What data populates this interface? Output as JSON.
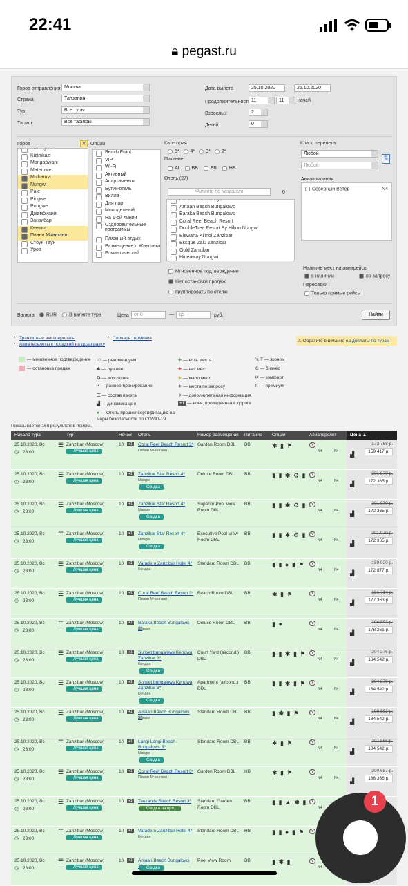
{
  "status": {
    "time": "22:41"
  },
  "browser": {
    "url": "pegast.ru"
  },
  "form": {
    "city_from_label": "Город отправления",
    "city_from": "Москва",
    "country_label": "Страна",
    "country": "Танзания",
    "tour_label": "Тур",
    "tour": "Все туры",
    "tariff_label": "Тариф",
    "tariff": "Все тарифы",
    "date_label": "Дата вылета",
    "date_from": "25.10.2020",
    "date_to": "25.10.2020",
    "duration_label": "Продолжительность",
    "dur_from": "11",
    "dur_to": "11",
    "nights": "ночей",
    "adults_label": "Взрослых",
    "adults": "2",
    "children_label": "Детей",
    "children": "0",
    "city_label": "Город",
    "options_label": "Опции",
    "category_label": "Категория",
    "cats": [
      "5*",
      "4*",
      "3*",
      "2*"
    ],
    "meal_label": "Питание",
    "meals": [
      "AI",
      "BB",
      "FB",
      "HB"
    ],
    "hotel_label": "Отель (27)",
    "hotel_placeholder": "Фильтр по названию",
    "hotel_count": "0",
    "class_label": "Класс перелета",
    "class_1": "Любой",
    "class_2": "Любой",
    "airlines_label": "Авиакомпании",
    "airline": "Северный Ветер",
    "airline_code": "N4",
    "avail_label": "Наличие мест на авиарейсы",
    "avail_yes": "в наличии",
    "avail_req": "по запросу",
    "transfers_label": "Пересадки",
    "direct_only": "Только прямые рейсы",
    "instant": "Мгновенное подтверждение",
    "no_stop": "Нет остановки продаж",
    "group": "Группировать по отелю",
    "currency_label": "Валюта",
    "cur_rub": "RUR",
    "cur_tour": "В валюте тура",
    "price_label": "Цена",
    "price_from": "от 0",
    "price_to": "до --",
    "rub": "руб.",
    "find": "Найти",
    "cities": [
      {
        "n": "Kiwengwa",
        "on": false
      },
      {
        "n": "Kizimkazi",
        "on": false
      },
      {
        "n": "Mangapwani",
        "on": false
      },
      {
        "n": "Matemwe",
        "on": false
      },
      {
        "n": "Michamvi",
        "on": true
      },
      {
        "n": "Nungwi",
        "on": true
      },
      {
        "n": "Paje",
        "on": false
      },
      {
        "n": "Pingwe",
        "on": false
      },
      {
        "n": "Pongwe",
        "on": false
      },
      {
        "n": "Джамбиани",
        "on": false
      },
      {
        "n": "Занзибар",
        "on": false
      },
      {
        "n": "Кендва",
        "on": true
      },
      {
        "n": "Пвани Мчангани",
        "on": true
      },
      {
        "n": "Стоун Таун",
        "on": false
      },
      {
        "n": "Уроа",
        "on": false
      }
    ],
    "options": [
      "Beach Front",
      "VIP",
      "Wi-Fi",
      "Активный",
      "Апартаменты",
      "Бутик-отель",
      "Вилла",
      "Для пар",
      "Молодежный",
      "На 1-ой линии",
      "Оздоровительные программы",
      "Пляжный отдых",
      "Размещение с Животными",
      "Романтический"
    ],
    "hotels": [
      "Aluna Beach Lodge",
      "Amaan Beach Bungalows",
      "Baraka Beach Bungalows",
      "Coral Reef Beach Resort",
      "DoubleTree Resort By Hilton Nungwi",
      "Elewana Kilindi Zanzibar",
      "Essque Zalu Zanzibar",
      "Gold Zanzibar",
      "Hideaway Nungwi"
    ]
  },
  "links": {
    "transit": "Транзитные авиаперелеты",
    "terms": "Словарь терминов",
    "flights": "Авиаперелеты с посадкой на дозаправку",
    "notice": "Обратите внимание",
    "extra": "на доплаты по турам"
  },
  "legend": {
    "instant": "— мгновенное подтверждение",
    "stop": "— остановка продаж",
    "rec": "— рекомендуем",
    "best": "— лучшее",
    "excl": "— эксклюзив",
    "early": "— раннее бронирование",
    "pack": "— состав пакета",
    "dyn": "— динамика цен",
    "covid": "— Отель прошел сертификацию на меры безопасности по COVID-19",
    "seats": "— есть места",
    "noseats": "— нет мест",
    "few": "— мало мест",
    "req": "— места по запросу",
    "info": "— дополнительная информация",
    "night": "— ночь, проведенная в дороге",
    "econ": "Y, T — эконом",
    "bus": "C — бизнес",
    "comf": "K — комфорт",
    "prem": "P — премиум"
  },
  "results_count": "Показывается 168 результатов поиска.",
  "table": {
    "h_start": "Начало тура",
    "h_tour": "Тур",
    "h_nights": "Ночей",
    "h_hotel": "Отель",
    "h_room": "Номер размещения",
    "h_meal": "Питание",
    "h_opts": "Опции",
    "h_air": "Авиаперелет",
    "h_price": "Цена ▲"
  },
  "rows": [
    {
      "date": "25.10.2020, Вс",
      "time": "23:00",
      "tour": "Zanzibar (Moscow)",
      "badge": "Лучшая цена",
      "n": "10",
      "hotel": "Coral Reef Beach Resort 3*",
      "town": "Пвани Мчангани",
      "room": "Garden Room DBL",
      "meal": "BB",
      "icons": "✱ ▮ ⚑",
      "old": "173 768 р.",
      "price": "159 417 р.",
      "extra": ""
    },
    {
      "date": "25.10.2020, Вс",
      "time": "23:00",
      "tour": "Zanzibar (Moscow)",
      "badge": "Лучшая цена",
      "n": "10",
      "hotel": "Zanzibar Star Resort 4*",
      "town": "Nungwi",
      "room": "Deluxe Room DBL",
      "meal": "BB",
      "icons": "▮ ▮ ✱ ⚙ ▮ ⚑",
      "old": "201 970 р.",
      "price": "172 365 р.",
      "extra": "Скидка"
    },
    {
      "date": "25.10.2020, Вс",
      "time": "23:00",
      "tour": "Zanzibar (Moscow)",
      "badge": "Лучшая цена",
      "n": "10",
      "hotel": "Zanzibar Star Resort 4*",
      "town": "Nungwi",
      "room": "Superior Pool View Room DBL",
      "meal": "BB",
      "icons": "▮ ▮ ✱ ⚙ ▮ ⚑",
      "old": "201 970 р.",
      "price": "172 365 р.",
      "extra": "Скидка"
    },
    {
      "date": "25.10.2020, Вс",
      "time": "23:00",
      "tour": "Zanzibar (Moscow)",
      "badge": "Лучшая цена",
      "n": "10",
      "hotel": "Zanzibar Star Resort 4*",
      "town": "Nungwi",
      "room": "Executive Pool View Room DBL",
      "meal": "BB",
      "icons": "▮ ▮ ✱ ⚙ ▮ ⚑",
      "old": "201 970 р.",
      "price": "172 365 р.",
      "extra": "Скидка"
    },
    {
      "date": "25.10.2020, Вс",
      "time": "23:00",
      "tour": "Zanzibar (Moscow)",
      "badge": "Лучшая цена",
      "n": "10",
      "hotel": "Varadero Zanzibar Hotel 4*",
      "town": "Кендва",
      "room": "Standard Room DBL",
      "meal": "BB",
      "icons": "▮ ▮ ● ▮ ⚑",
      "old": "189 920 р.",
      "price": "172 877 р.",
      "extra": ""
    },
    {
      "date": "25.10.2020, Вс",
      "time": "23:00",
      "tour": "Zanzibar (Moscow)",
      "badge": "Лучшая цена",
      "n": "10",
      "hotel": "Coral Reef Beach Resort 3*",
      "town": "Пвани Мчангани",
      "room": "Beach Room DBL",
      "meal": "BB",
      "icons": "✱ ▮ ⚑",
      "old": "191 714 р.",
      "price": "177 363 р.",
      "extra": ""
    },
    {
      "date": "25.10.2020, Вс",
      "time": "23:00",
      "tour": "Zanzibar (Moscow)",
      "badge": "Лучшая цена",
      "n": "10",
      "hotel": "Baraka Beach Bungalows 2*",
      "town": "Nungwi",
      "room": "Deluxe Room DBL",
      "meal": "BB",
      "icons": "▮ ●",
      "old": "198 893 р.",
      "price": "178 261 р.",
      "extra": ""
    },
    {
      "date": "25.10.2020, Вс",
      "time": "23:00",
      "tour": "Zanzibar (Moscow)",
      "badge": "Лучшая цена",
      "n": "10",
      "hotel": "Sunset bungalows Kendwa Zanzibar 3*",
      "town": "Кендва",
      "room": "Court Yard (aircond.) DBL",
      "meal": "BB",
      "icons": "▮ ▮ ✱ ▮ ⚑",
      "old": "204 276 р.",
      "price": "184 542 р.",
      "extra": "Скидка"
    },
    {
      "date": "25.10.2020, Вс",
      "time": "23:00",
      "tour": "Zanzibar (Moscow)",
      "badge": "Лучшая цена",
      "n": "10",
      "hotel": "Sunset bungalows Kendwa Zanzibar 3*",
      "town": "Кендва",
      "room": "Apartment (aircond.) DBL",
      "meal": "BB",
      "icons": "▮ ▮ ✱ ▮ ⚑",
      "old": "204 276 р.",
      "price": "184 542 р.",
      "extra": "Скидка"
    },
    {
      "date": "25.10.2020, Вс",
      "time": "23:00",
      "tour": "Zanzibar (Moscow)",
      "badge": "Лучшая цена",
      "n": "10",
      "hotel": "Amaan Beach Bungalows 3*",
      "town": "Nungwi",
      "room": "Standard Room DBL",
      "meal": "BB",
      "icons": "▮ ✱ ▮ ⚑",
      "old": "198 893 р.",
      "price": "184 542 р.",
      "extra": ""
    },
    {
      "date": "25.10.2020, Вс",
      "time": "23:00",
      "tour": "Zanzibar (Moscow)",
      "badge": "Лучшая цена",
      "n": "10",
      "hotel": "Langi Langi Beach Bungalows 3*",
      "town": "Nungwi",
      "room": "Standard Room DBL",
      "meal": "BB",
      "icons": "✱ ▮ ⚑",
      "old": "207 866 р.",
      "price": "184 542 р.",
      "extra": "Скидка"
    },
    {
      "date": "25.10.2020, Вс",
      "time": "23:00",
      "tour": "Zanzibar (Moscow)",
      "badge": "Лучшая цена",
      "n": "10",
      "hotel": "Coral Reef Beach Resort 3*",
      "town": "Пвани Мчангани",
      "room": "Garden Room DBL",
      "meal": "HB",
      "icons": "✱ ▮ ⚑",
      "old": "200 687 р.",
      "price": "186 336 р.",
      "extra": ""
    },
    {
      "date": "25.10.2020, Вс",
      "time": "23:00",
      "tour": "Zanzibar (Moscow)",
      "badge": "Лучшая цена",
      "n": "10",
      "hotel": "Tanzanite Beach Resort 3*",
      "town": "",
      "room": "Standard Garden Room DBL",
      "meal": "BB",
      "icons": "▮ ▮ ▲ ✱ ▮ ⚑",
      "old": "",
      "price": "",
      "extra": "Скидка на про..."
    },
    {
      "date": "25.10.2020, Вс",
      "time": "23:00",
      "tour": "Zanzibar (Moscow)",
      "badge": "Лучшая цена",
      "n": "10",
      "hotel": "Varadero Zanzibar Hotel 4*",
      "town": "Кендва",
      "room": "Standard Room DBL",
      "meal": "HB",
      "icons": "▮ ▮ ● ▮ ⚑",
      "old": "",
      "price": "",
      "extra": ""
    },
    {
      "date": "25.10.2020, Вс",
      "time": "23:00",
      "tour": "Zanzibar (Moscow)",
      "badge": "Лучшая цена",
      "n": "10",
      "hotel": "Amaan Beach Bungalows 3*",
      "town": "",
      "room": "Pool View Room",
      "meal": "BB",
      "icons": "▮ ✱ ▮",
      "old": "225 812 р.",
      "price": "202 488 р.",
      "extra": "Скидка"
    }
  ],
  "chat": {
    "count": "1"
  }
}
